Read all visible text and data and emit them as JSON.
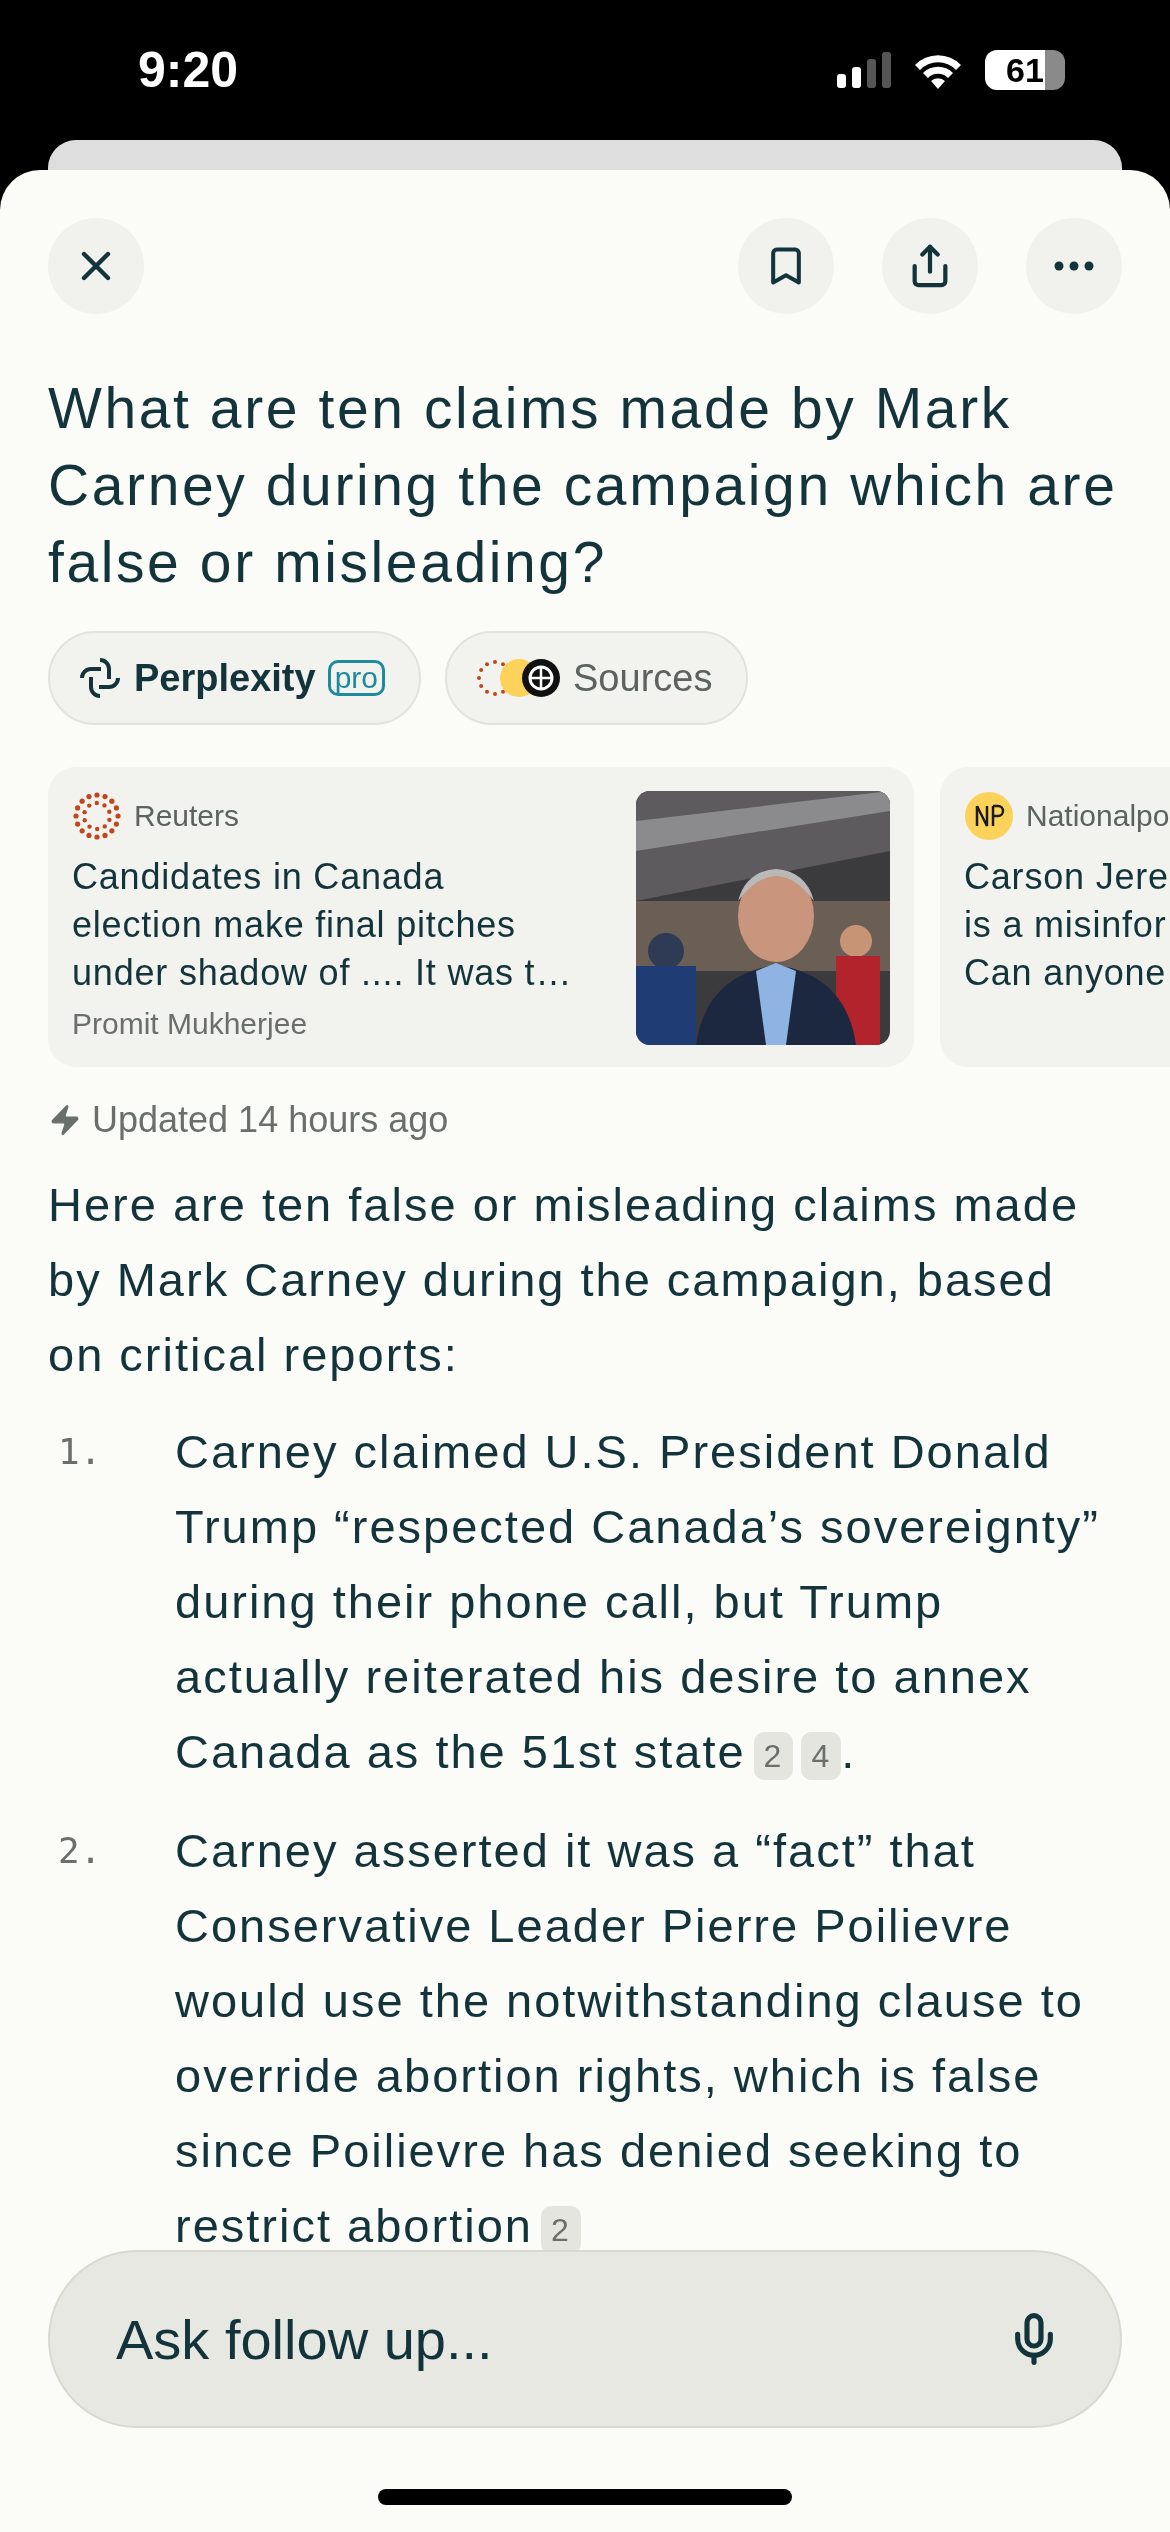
{
  "status_bar": {
    "time": "9:20",
    "battery": "61"
  },
  "title": "What are ten claims made by Mark Carney during the campaign which are false or misleading?",
  "chips": [
    {
      "kind": "model",
      "label": "Perplexity",
      "badge": "pro"
    },
    {
      "kind": "sources",
      "label": "Sources"
    }
  ],
  "cards": [
    {
      "kind": "reuters",
      "source": "Reuters",
      "lines": [
        "Candidates in Canada",
        "election make final pitches",
        "under shadow of .... It was t…"
      ],
      "author": "Promit Mukherjee"
    },
    {
      "kind": "np",
      "source": "Nationalpo",
      "lines": [
        "Carson Jere",
        "is a misinfor",
        "Can anyone"
      ]
    }
  ],
  "updated": "Updated 14 hours ago",
  "intro": "Here are ten false or misleading claims made by Mark Carney during the campaign, based on critical reports:",
  "items": [
    {
      "number": "1.",
      "text": "Carney claimed U.S. President Donald Trump “respected Canada’s sovereignty” during their phone call, but Trump actually reiterated his desire to annex Canada as the 51st state",
      "citations": [
        "2",
        "4"
      ],
      "end": "."
    },
    {
      "number": "2.",
      "text": "Carney asserted it was a “fact” that Conservative Leader Pierre Poilievre would use the notwithstanding clause to override abortion rights, which is false since Poilievre has denied seeking to restrict abortion",
      "citations": [
        "2"
      ]
    }
  ],
  "follow_up": {
    "placeholder": "Ask follow up..."
  }
}
